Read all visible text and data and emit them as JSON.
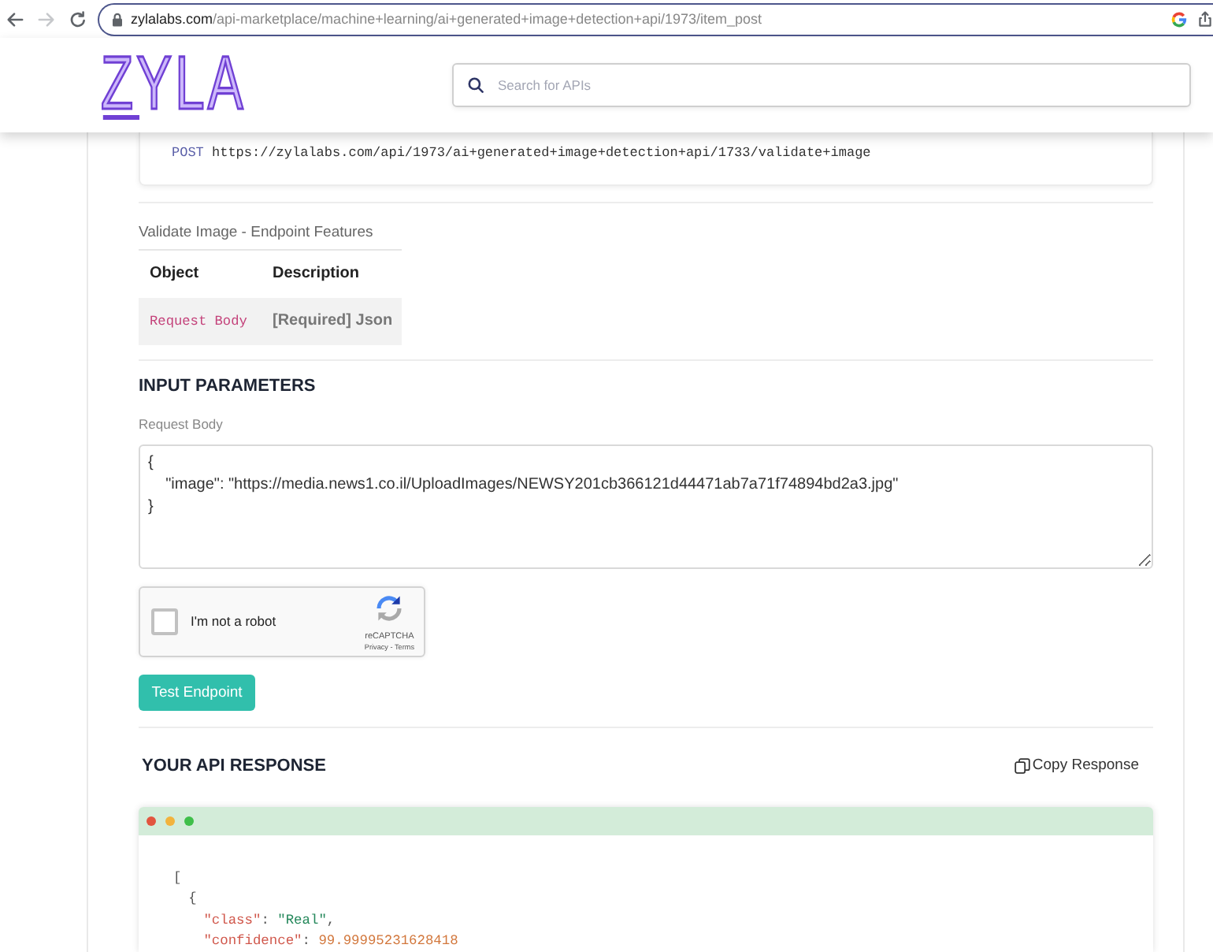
{
  "browser": {
    "nav": [
      {
        "kind": "back",
        "disabled": false
      },
      {
        "kind": "forward",
        "disabled": true
      },
      {
        "kind": "reload",
        "disabled": false
      }
    ],
    "url_host": "zylalabs.com",
    "url_path": "/api-marketplace/machine+learning/ai+generated+image+detection+api/1973/item_post"
  },
  "header": {
    "logo": "ZYLA",
    "search": {
      "placeholder": "Search for APIs"
    }
  },
  "endpoint": {
    "method": "POST",
    "url": "https://zylalabs.com/api/1973/ai+generated+image+detection+api/1733/validate+image"
  },
  "features": {
    "title": "Validate Image - Endpoint Features",
    "columns": [
      "Object",
      "Description"
    ],
    "rows": [
      [
        "Request Body",
        "[Required] Json"
      ]
    ]
  },
  "input_parameters": {
    "heading": "INPUT PARAMETERS",
    "label": "Request Body",
    "value": "{\n    \"image\": \"https://media.news1.co.il/UploadImages/NEWSY201cb366121d44471ab7a71f74894bd2a3.jpg\"\n}"
  },
  "captcha": {
    "label": "I'm not a robot",
    "checked": false,
    "brand": "reCAPTCHA",
    "links": "Privacy - Terms"
  },
  "test_button": {
    "label": "Test Endpoint"
  },
  "response": {
    "heading": "YOUR API RESPONSE",
    "copy_label": "Copy Response",
    "lines": [
      {
        "tokens": [
          {
            "kind": "punct",
            "text": "["
          }
        ],
        "children": [
          {
            "tokens": [
              {
                "kind": "punct",
                "text": "{"
              }
            ],
            "children": [
              {
                "tokens": [
                  {
                    "kind": "key",
                    "text": "\"class\""
                  },
                  {
                    "kind": "punct",
                    "text": ": "
                  },
                  {
                    "kind": "string",
                    "text": "\"Real\""
                  },
                  {
                    "kind": "punct",
                    "text": ","
                  }
                ]
              },
              {
                "tokens": [
                  {
                    "kind": "key",
                    "text": "\"confidence\""
                  },
                  {
                    "kind": "punct",
                    "text": ": "
                  },
                  {
                    "kind": "number",
                    "text": "99.99995231628418"
                  }
                ]
              }
            ]
          }
        ]
      }
    ]
  }
}
